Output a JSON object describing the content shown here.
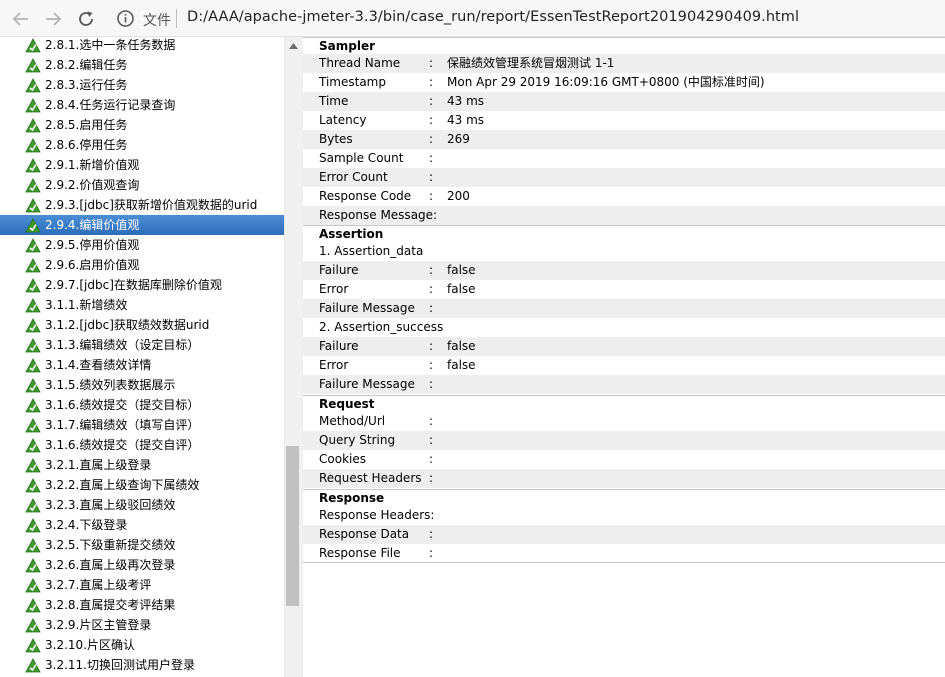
{
  "browser": {
    "file_label": "文件",
    "url": "D:/AAA/apache-jmeter-3.3/bin/case_run/report/EssenTestReport201904290409.html"
  },
  "tree": {
    "items": [
      {
        "label": "2.8.1.选中一条任务数据",
        "selected": false
      },
      {
        "label": "2.8.2.编辑任务",
        "selected": false
      },
      {
        "label": "2.8.3.运行任务",
        "selected": false
      },
      {
        "label": "2.8.4.任务运行记录查询",
        "selected": false
      },
      {
        "label": "2.8.5.启用任务",
        "selected": false
      },
      {
        "label": "2.8.6.停用任务",
        "selected": false
      },
      {
        "label": "2.9.1.新增价值观",
        "selected": false
      },
      {
        "label": "2.9.2.价值观查询",
        "selected": false
      },
      {
        "label": "2.9.3.[jdbc]获取新增价值观数据的urid",
        "selected": false
      },
      {
        "label": "2.9.4.编辑价值观",
        "selected": true
      },
      {
        "label": "2.9.5.停用价值观",
        "selected": false
      },
      {
        "label": "2.9.6.启用价值观",
        "selected": false
      },
      {
        "label": "2.9.7.[jdbc]在数据库删除价值观",
        "selected": false
      },
      {
        "label": "3.1.1.新增绩效",
        "selected": false
      },
      {
        "label": "3.1.2.[jdbc]获取绩效数据urid",
        "selected": false
      },
      {
        "label": "3.1.3.编辑绩效（设定目标）",
        "selected": false
      },
      {
        "label": "3.1.4.查看绩效详情",
        "selected": false
      },
      {
        "label": "3.1.5.绩效列表数据展示",
        "selected": false
      },
      {
        "label": "3.1.6.绩效提交（提交目标）",
        "selected": false
      },
      {
        "label": "3.1.7.编辑绩效（填写自评）",
        "selected": false
      },
      {
        "label": "3.1.6.绩效提交（提交自评）",
        "selected": false
      },
      {
        "label": "3.2.1.直属上级登录",
        "selected": false
      },
      {
        "label": "3.2.2.直属上级查询下属绩效",
        "selected": false
      },
      {
        "label": "3.2.3.直属上级驳回绩效",
        "selected": false
      },
      {
        "label": "3.2.4.下级登录",
        "selected": false
      },
      {
        "label": "3.2.5.下级重新提交绩效",
        "selected": false
      },
      {
        "label": "3.2.6.直属上级再次登录",
        "selected": false
      },
      {
        "label": "3.2.7.直属上级考评",
        "selected": false
      },
      {
        "label": "3.2.8.直属提交考评结果",
        "selected": false
      },
      {
        "label": "3.2.9.片区主管登录",
        "selected": false
      },
      {
        "label": "3.2.10.片区确认",
        "selected": false
      },
      {
        "label": "3.2.11.切换回测试用户登录",
        "selected": false
      }
    ]
  },
  "detail": {
    "sampler": {
      "title": "Sampler",
      "rows": [
        {
          "key": "Thread Name",
          "value": "保融绩效管理系统冒烟测试 1-1"
        },
        {
          "key": "Timestamp",
          "value": "Mon Apr 29 2019 16:09:16 GMT+0800 (中国标准时间)"
        },
        {
          "key": "Time",
          "value": "43 ms"
        },
        {
          "key": "Latency",
          "value": "43 ms"
        },
        {
          "key": "Bytes",
          "value": "269"
        },
        {
          "key": "Sample Count",
          "value": ""
        },
        {
          "key": "Error Count",
          "value": ""
        },
        {
          "key": "Response Code",
          "value": "200"
        },
        {
          "key": "Response Message:",
          "value": ""
        }
      ]
    },
    "assertion": {
      "title": "Assertion",
      "groups": [
        {
          "name": "1. Assertion_data",
          "rows": [
            {
              "key": "Failure",
              "value": "false"
            },
            {
              "key": "Error",
              "value": "false"
            },
            {
              "key": "Failure Message",
              "value": ""
            }
          ]
        },
        {
          "name": "2. Assertion_success",
          "rows": [
            {
              "key": "Failure",
              "value": "false"
            },
            {
              "key": "Error",
              "value": "false"
            },
            {
              "key": "Failure Message",
              "value": ""
            }
          ]
        }
      ]
    },
    "request": {
      "title": "Request",
      "rows": [
        {
          "key": "Method/Url",
          "value": ""
        },
        {
          "key": "Query String",
          "value": ""
        },
        {
          "key": "Cookies",
          "value": ""
        },
        {
          "key": "Request Headers",
          "value": ""
        }
      ]
    },
    "response": {
      "title": "Response",
      "rows": [
        {
          "key": "Response Headers:",
          "value": ""
        },
        {
          "key": "Response Data",
          "value": ""
        },
        {
          "key": "Response File",
          "value": ""
        }
      ]
    },
    "separator": ":"
  },
  "icons": {
    "back": "arrow-left-icon",
    "forward": "arrow-right-icon",
    "reload": "reload-icon",
    "info": "info-icon",
    "tree_item": "sampler-pass-icon",
    "scroll_up": "triangle-up-icon"
  },
  "colors": {
    "selected_row": "#3a7cc6",
    "alt_row": "#eeeeee",
    "icon_green": "#3d9a2b"
  }
}
